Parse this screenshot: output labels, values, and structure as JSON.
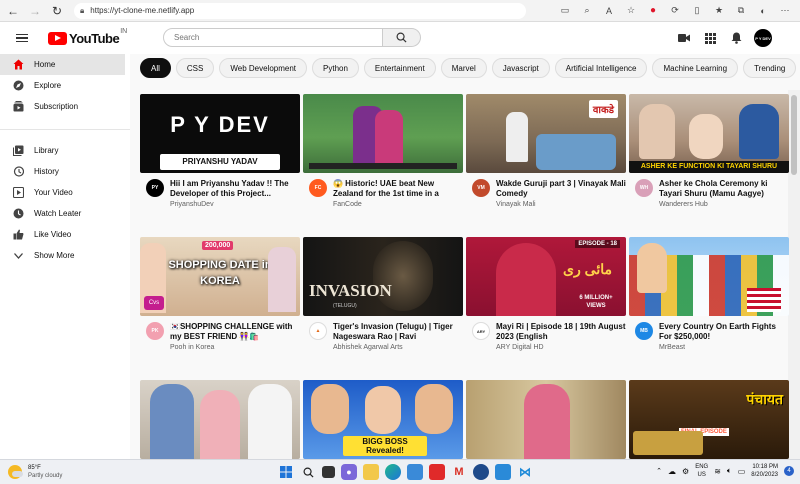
{
  "browser": {
    "url": "https://yt-clone-me.netlify.app"
  },
  "header": {
    "logo_text": "YouTube",
    "logo_region": "IN",
    "search_placeholder": "Search",
    "avatar_text": "P Y DEV"
  },
  "sidebar": {
    "items": [
      {
        "label": "Home",
        "icon": "home-icon"
      },
      {
        "label": "Explore",
        "icon": "explore-icon"
      },
      {
        "label": "Subscription",
        "icon": "subscription-icon"
      },
      {
        "label": "Library",
        "icon": "library-icon"
      },
      {
        "label": "History",
        "icon": "history-icon"
      },
      {
        "label": "Your Video",
        "icon": "your-video-icon"
      },
      {
        "label": "Watch Leater",
        "icon": "watch-later-icon"
      },
      {
        "label": "Like Video",
        "icon": "like-icon"
      },
      {
        "label": "Show More",
        "icon": "chevron-down-icon"
      }
    ]
  },
  "chips": [
    "All",
    "CSS",
    "Web Development",
    "Python",
    "Entertainment",
    "Marvel",
    "Javascript",
    "Artificial Intelligence",
    "Machine Learning",
    "Trending"
  ],
  "videos": [
    {
      "title": "Hii I am Priyanshu Yadav !! The Developer of this Project...",
      "channel": "PriyanshuDev",
      "thumb_text": "P Y DEV",
      "thumb_sub": "PRIYANSHU YADAV"
    },
    {
      "title": "😱 Historic! UAE beat New Zealand for the 1st time in a",
      "channel": "FanCode",
      "thumb_text": "",
      "thumb_sub": ""
    },
    {
      "title": "Wakde Guruji part 3 | Vinayak Mali Comedy",
      "channel": "Vinayak Mali",
      "thumb_text": "वाकडे",
      "thumb_sub": ""
    },
    {
      "title": "Asher ke Chola Ceremony ki Tayari Shuru (Mamu Aagye)",
      "channel": "Wanderers Hub",
      "thumb_text": "ASHER KE FUNCTION KI TAYARI SHURU",
      "thumb_sub": ""
    },
    {
      "title": "🇰🇷SHOPPING CHALLENGE with my BEST FRIEND 👭🛍️",
      "channel": "Pooh in Korea",
      "thumb_text": "SHOPPING DATE in KOREA",
      "thumb_sub": "200,000"
    },
    {
      "title": "Tiger's Invasion (Telugu) | Tiger Nageswara Rao | Ravi",
      "channel": "Abhishek Agarwal Arts",
      "thumb_text": "INVASION",
      "thumb_sub": "(TELUGU)"
    },
    {
      "title": "Mayi Ri | Episode 18 | 19th August 2023 (English",
      "channel": "ARY Digital HD",
      "thumb_text": "EPISODE - 18",
      "thumb_sub": "6 MILLION+ VIEWS"
    },
    {
      "title": "Every Country On Earth Fights For $250,000!",
      "channel": "MrBeast",
      "thumb_text": "",
      "thumb_sub": ""
    },
    {
      "title": "",
      "channel": "",
      "thumb_text": "",
      "thumb_sub": ""
    },
    {
      "title": "",
      "channel": "",
      "thumb_text": "BIGG BOSS Revealed!",
      "thumb_sub": ""
    },
    {
      "title": "",
      "channel": "",
      "thumb_text": "",
      "thumb_sub": ""
    },
    {
      "title": "",
      "channel": "",
      "thumb_text": "FINAL EPISODE",
      "thumb_sub": ""
    }
  ],
  "taskbar": {
    "temp": "85°F",
    "weather": "Partly cloudy",
    "lang1": "ENG",
    "lang2": "US",
    "time": "10:18 PM",
    "date": "8/20/2023",
    "notifications": "4"
  }
}
